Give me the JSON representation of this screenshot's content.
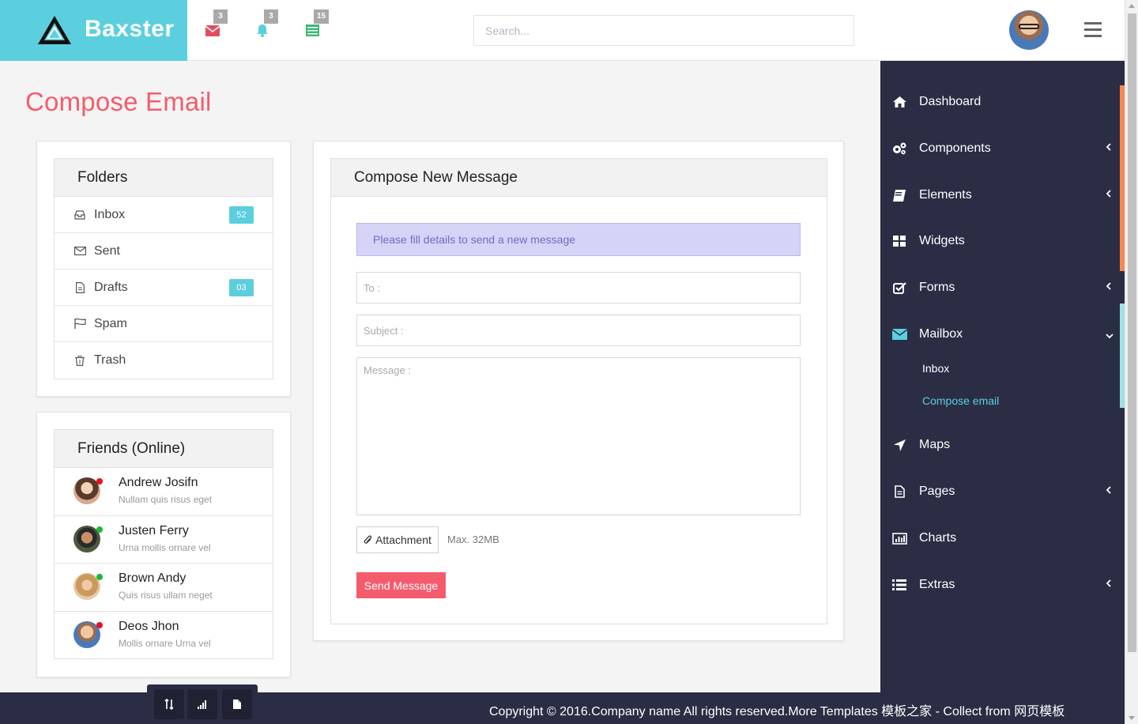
{
  "brand": {
    "name": "Baxster"
  },
  "header": {
    "notifications": [
      {
        "icon": "envelope-icon",
        "count": "3",
        "color": "#e04f5f"
      },
      {
        "icon": "bell-icon",
        "count": "3",
        "color": "#5bcfdd"
      },
      {
        "icon": "list-icon",
        "count": "15",
        "color": "#3cb878"
      }
    ],
    "search_placeholder": "Search..."
  },
  "page": {
    "title": "Compose Email"
  },
  "folders": {
    "title": "Folders",
    "items": [
      {
        "label": "Inbox",
        "icon": "inbox-icon",
        "badge": "52"
      },
      {
        "label": "Sent",
        "icon": "envelope-outline-icon",
        "badge": ""
      },
      {
        "label": "Drafts",
        "icon": "file-icon",
        "badge": "03"
      },
      {
        "label": "Spam",
        "icon": "flag-icon",
        "badge": ""
      },
      {
        "label": "Trash",
        "icon": "trash-icon",
        "badge": ""
      }
    ]
  },
  "friends": {
    "title": "Friends (Online)",
    "items": [
      {
        "name": "Andrew Josifn",
        "sub": "Nullam quis risus eget",
        "status": "#e81123"
      },
      {
        "name": "Justen Ferry",
        "sub": "Urna mollis ornare vel",
        "status": "#1bb935"
      },
      {
        "name": "Brown Andy",
        "sub": "Quis risus ullam neget",
        "status": "#1bb935"
      },
      {
        "name": "Deos Jhon",
        "sub": "Mollis ornare Urna vel",
        "status": "#e81123"
      }
    ]
  },
  "compose": {
    "title": "Compose New Message",
    "alert": "Please fill details to send a new message",
    "to_placeholder": "To :",
    "subject_placeholder": "Subject :",
    "message_placeholder": "Message :",
    "attachment_label": "Attachment",
    "max_size": "Max. 32MB",
    "send_label": "Send Message"
  },
  "sidebar": {
    "items": [
      {
        "label": "Dashboard",
        "icon": "home-icon",
        "has_children": false
      },
      {
        "label": "Components",
        "icon": "cogs-icon",
        "has_children": true
      },
      {
        "label": "Elements",
        "icon": "book-icon",
        "has_children": true
      },
      {
        "label": "Widgets",
        "icon": "grid-icon",
        "has_children": false
      },
      {
        "label": "Forms",
        "icon": "check-square-icon",
        "has_children": true
      },
      {
        "label": "Mailbox",
        "icon": "envelope-icon",
        "has_children": true,
        "expanded": true
      },
      {
        "label": "Maps",
        "icon": "location-arrow-icon",
        "has_children": false
      },
      {
        "label": "Pages",
        "icon": "file-icon",
        "has_children": true
      },
      {
        "label": "Charts",
        "icon": "bar-chart-icon",
        "has_children": false
      },
      {
        "label": "Extras",
        "icon": "list-icon",
        "has_children": true
      }
    ],
    "mailbox_sub": [
      {
        "label": "Inbox",
        "active": false
      },
      {
        "label": "Compose email",
        "active": true
      }
    ],
    "active_color": "#5bcfdd"
  },
  "footer": {
    "copyright": "Copyright © 2016.Company name All rights reserved.More Templates 模板之家 - Collect from 网页模板",
    "tools": [
      "sort-icon",
      "signal-icon",
      "file-icon"
    ]
  }
}
